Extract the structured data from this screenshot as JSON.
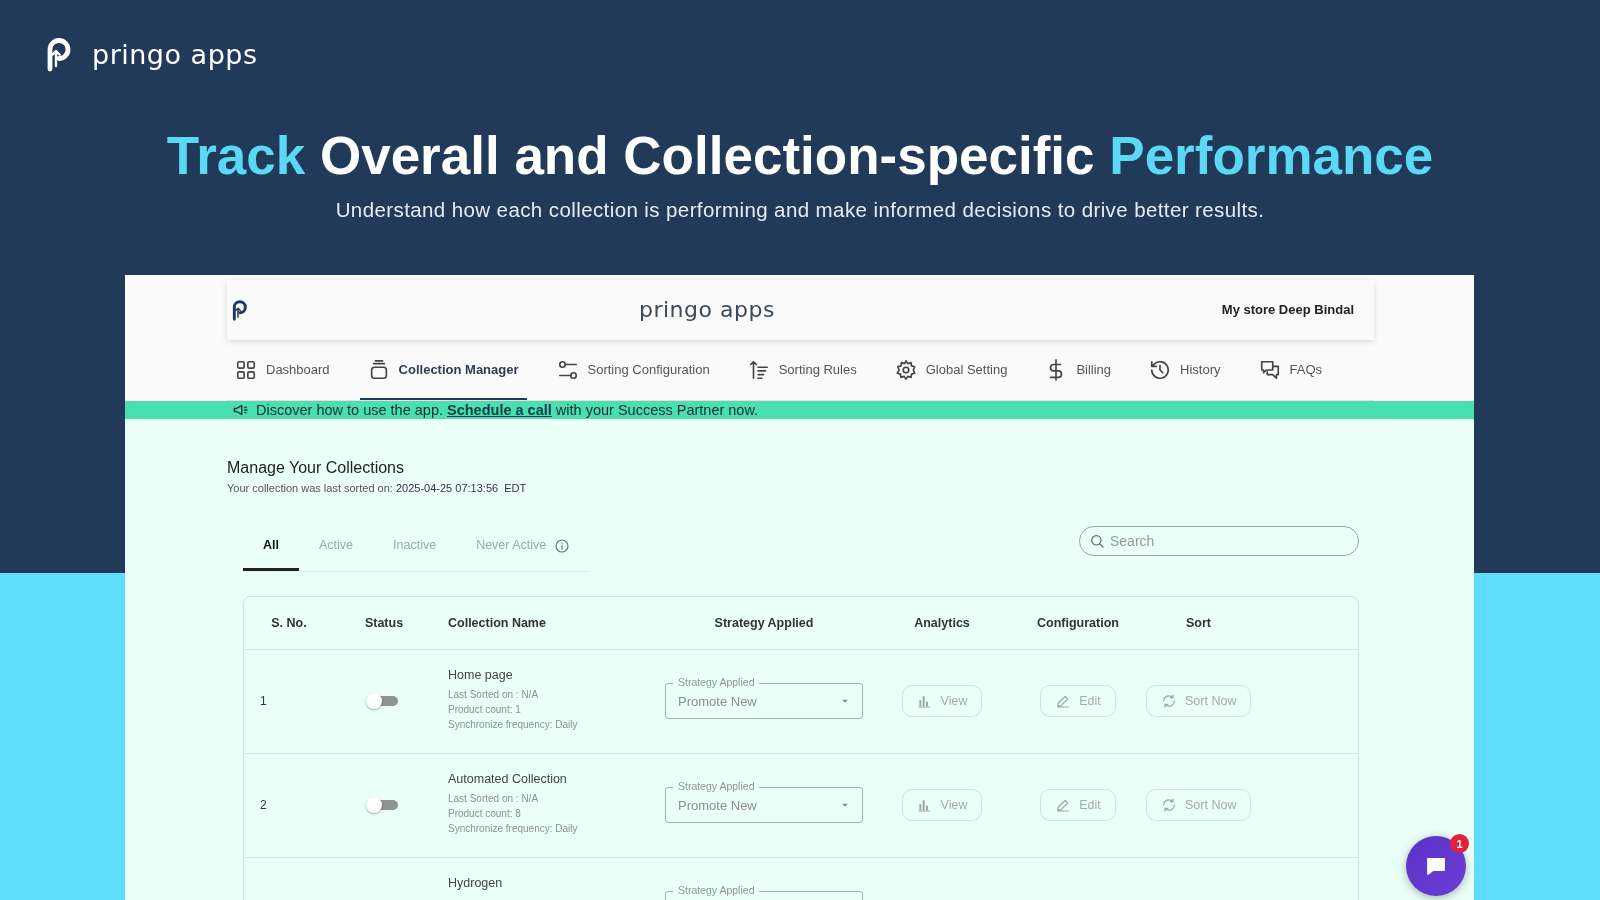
{
  "brand": {
    "name": "pringo apps"
  },
  "headline": [
    {
      "text": "Track",
      "highlight": true
    },
    {
      "text": "Overall and Collection-specific",
      "highlight": false
    },
    {
      "text": "Performance",
      "highlight": true
    }
  ],
  "subtitle": "Understand how each collection is performing and make informed decisions to drive better results.",
  "app": {
    "brand": "pringo apps",
    "store": "My store Deep Bindal",
    "nav": [
      {
        "label": "Dashboard",
        "selected": false
      },
      {
        "label": "Collection Manager",
        "selected": true
      },
      {
        "label": "Sorting Configuration",
        "selected": false
      },
      {
        "label": "Sorting Rules",
        "selected": false
      },
      {
        "label": "Global Setting",
        "selected": false
      },
      {
        "label": "Billing",
        "selected": false
      },
      {
        "label": "History",
        "selected": false
      },
      {
        "label": "FAQs",
        "selected": false
      }
    ],
    "banner": {
      "before": "Discover how to use the app.",
      "link": "Schedule a call",
      "after": "with your Success Partner now."
    },
    "title": "Manage Your Collections",
    "last_sorted": {
      "label": "Your collection was last sorted on:",
      "value": "2025-04-25 07:13:56",
      "zone": "EDT"
    },
    "filters": [
      {
        "label": "All",
        "selected": true,
        "info": false
      },
      {
        "label": "Active",
        "selected": false,
        "info": false
      },
      {
        "label": "Inactive",
        "selected": false,
        "info": false
      },
      {
        "label": "Never Active",
        "selected": false,
        "info": true
      }
    ],
    "search": {
      "placeholder": "Search"
    },
    "columns": [
      "S. No.",
      "Status",
      "Collection Name",
      "Strategy Applied",
      "Analytics",
      "Configuration",
      "Sort"
    ],
    "rows": [
      {
        "sno": "1",
        "on": false,
        "name": "Home page",
        "details": [
          "Last Sorted on : N/A",
          "Product count: 1",
          "Synchronize frequency: Daily"
        ],
        "strategy_label": "Strategy Applied",
        "strategy": "Promote New",
        "view": "View",
        "edit": "Edit",
        "sort": "Sort Now"
      },
      {
        "sno": "2",
        "on": false,
        "name": "Automated Collection",
        "details": [
          "Last Sorted on : N/A",
          "Product count: 8",
          "Synchronize frequency: Daily"
        ],
        "strategy_label": "Strategy Applied",
        "strategy": "Promote New",
        "view": "View",
        "edit": "Edit",
        "sort": "Sort Now"
      },
      {
        "name": "Hydrogen",
        "strategy_label": "Strategy Applied"
      }
    ]
  },
  "chat": {
    "badge": "1"
  }
}
